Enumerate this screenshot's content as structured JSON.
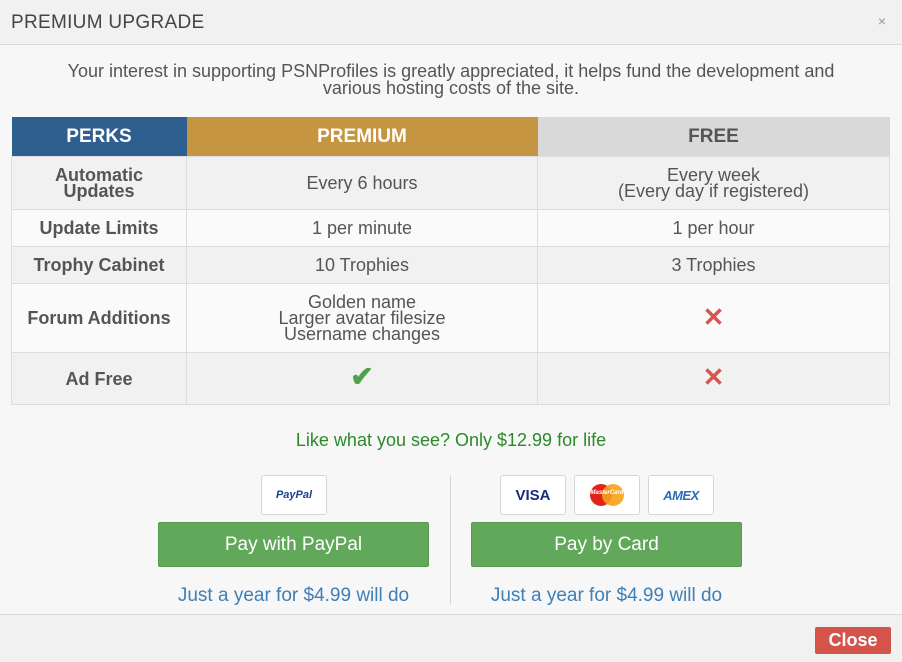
{
  "dialog": {
    "title": "PREMIUM UPGRADE",
    "close_x": "×",
    "intro_line1": "Your interest in supporting PSNProfiles is greatly appreciated, it helps fund the development and",
    "intro_line2": "various hosting costs of the site."
  },
  "table": {
    "headers": [
      "PERKS",
      "PREMIUM",
      "FREE"
    ],
    "rows": [
      {
        "label_line1": "Automatic",
        "label_line2": "Updates",
        "premium": "Every 6 hours",
        "free_line1": "Every week",
        "free_line2": "(Every day if registered)"
      },
      {
        "label": "Update Limits",
        "premium": "1 per minute",
        "free": "1 per hour"
      },
      {
        "label": "Trophy Cabinet",
        "premium": "10 Trophies",
        "free": "3 Trophies"
      },
      {
        "label": "Forum Additions",
        "premium_line1": "Golden name",
        "premium_line2": "Larger avatar filesize",
        "premium_line3": "Username changes",
        "free_icon": "cross-icon",
        "free_glyph": "✕"
      },
      {
        "label": "Ad Free",
        "premium_icon": "check-icon",
        "premium_glyph": "✔",
        "free_icon": "cross-icon",
        "free_glyph": "✕"
      }
    ]
  },
  "promo": "Like what you see? Only $12.99 for life",
  "payment": {
    "paypal_logo": "PayPal",
    "card_logos": {
      "visa": "VISA",
      "mastercard": "MasterCard",
      "amex": "AMEX"
    },
    "paypal_button": "Pay with PayPal",
    "card_button": "Pay by Card",
    "paypal_year_link": "Just a year for $4.99 will do",
    "card_year_link": "Just a year for $4.99 will do"
  },
  "footer": {
    "close_button": "Close"
  },
  "colors": {
    "perks_header": "#2f5f8f",
    "premium_header": "#c69541",
    "free_header": "#d9d9d9",
    "button_green": "#62a85b",
    "close_red": "#d4534b",
    "promo_green": "#2a8a2a",
    "link_blue": "#3f7fb6"
  }
}
